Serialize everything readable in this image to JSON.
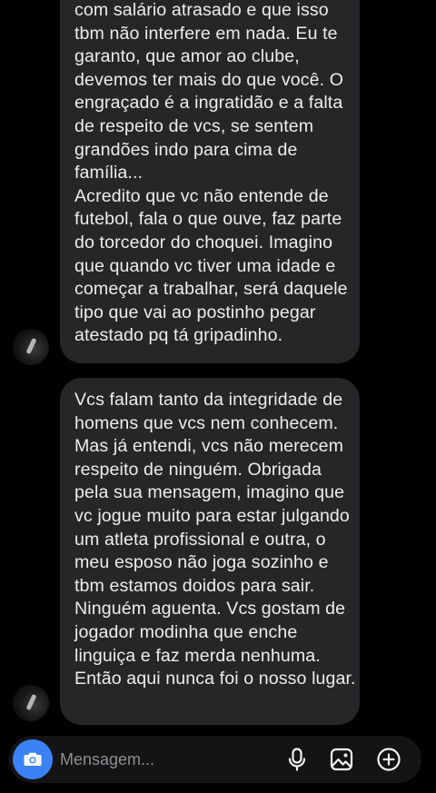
{
  "messages": [
    {
      "lines": [
        "com salário atrasado e que isso",
        "tbm não interfere em nada. Eu te",
        "garanto, que amor ao clube,",
        "devemos ter mais do que você. O",
        "engraçado é a ingratidão e a falta",
        "de respeito de vcs, se sentem",
        "grandões indo para cima de",
        "família...",
        "Acredito que vc não entende de",
        "futebol, fala o que ouve, faz parte",
        "do torcedor do choquei. Imagino",
        "que quando vc tiver uma idade e",
        "começar a trabalhar, será daquele",
        "tipo que vai ao postinho pegar",
        "atestado pq tá gripadinho."
      ]
    },
    {
      "lines": [
        "Vcs falam tanto da integridade de",
        "homens que vcs nem conhecem.",
        "Mas já entendi, vcs não merecem",
        "respeito de ninguém. Obrigada",
        "pela sua mensagem, imagino que",
        "vc jogue muito para estar julgando",
        "um atleta profissional e outra, o",
        "meu esposo não joga sozinho e",
        "tbm estamos doidos para sair.",
        "Ninguém aguenta. Vcs gostam de",
        "jogador modinha que enche",
        "linguiça e faz merda nenhuma.",
        "Então aqui nunca foi o nosso lugar."
      ]
    }
  ],
  "composer": {
    "placeholder": "Mensagem...",
    "icons": [
      "camera-icon",
      "microphone-icon",
      "gallery-icon",
      "plus-icon"
    ],
    "accent_color": "#3b82f6"
  }
}
